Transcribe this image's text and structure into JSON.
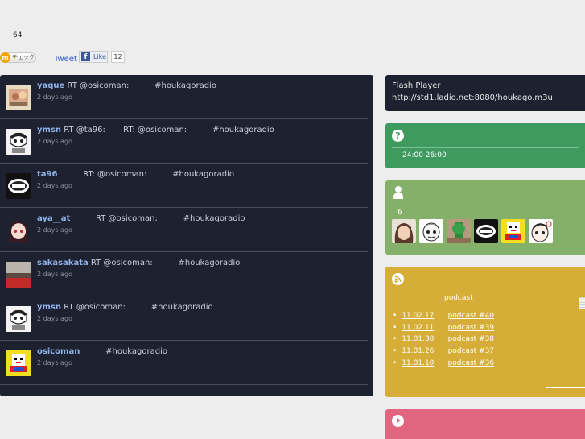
{
  "header": {
    "count": "64",
    "check_label": "チェック",
    "tweet_label": "Tweet",
    "like_label": "Like",
    "like_count": "12"
  },
  "timeline": [
    {
      "user": "yaque",
      "text": " RT @osicoman:          #houkagoradio",
      "time": "2 days ago",
      "avatar": "avatar-cat"
    },
    {
      "user": "ymsn",
      "text": " RT @ta96:       RT: @osicoman:          #houkagoradio",
      "time": "2 days ago",
      "avatar": "avatar-drawing"
    },
    {
      "user": "ta96",
      "text": "          RT: @osicoman:          #houkagoradio",
      "time": "2 days ago",
      "avatar": "avatar-logo"
    },
    {
      "user": "aya__at",
      "text": "          RT @osicoman:          #houkagoradio",
      "time": "2 days ago",
      "avatar": "avatar-anime"
    },
    {
      "user": "sakasakata",
      "text": " RT @osicoman:          #houkagoradio",
      "time": "2 days ago",
      "avatar": "avatar-red"
    },
    {
      "user": "ymsn",
      "text": " RT @osicoman:          #houkagoradio",
      "time": "2 days ago",
      "avatar": "avatar-drawing"
    },
    {
      "user": "osicoman",
      "text": "          #houkagoradio",
      "time": "2 days ago",
      "avatar": "avatar-pixel"
    }
  ],
  "sidebar": {
    "flash_title": "Flash Player",
    "stream_url": "http://std1.ladio.net:8080/houkago.m3u",
    "schedule_icon": "question-icon",
    "schedule_hours": "24:00 26:00",
    "members_icon": "person-icon",
    "members_count": "6",
    "podcast_icon": "rss-icon",
    "podcast_caption": "podcast",
    "podcasts": [
      {
        "date": "11.02.17",
        "title": "podcast #40"
      },
      {
        "date": "11.02.11",
        "title": "podcast #39"
      },
      {
        "date": "11.01.30",
        "title": "podcast #38"
      },
      {
        "date": "11.01.26",
        "title": "podcast #37"
      },
      {
        "date": "11.01.10",
        "title": "podcast #36"
      }
    ],
    "player_icon": "play-icon"
  },
  "colors": {
    "timeline_bg": "#1d2130",
    "green_panel": "#3f9a5f",
    "olive_panel": "#84b06a",
    "yellow_panel": "#d6ae37",
    "pink_panel": "#e06680",
    "username": "#8fb3e8"
  }
}
